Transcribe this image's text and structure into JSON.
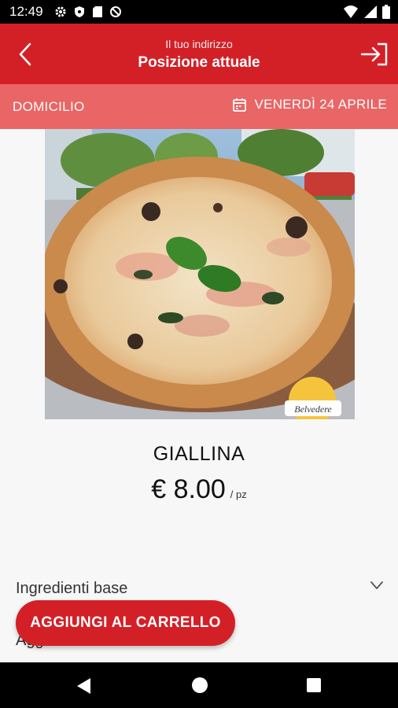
{
  "status_bar": {
    "time": "12:49",
    "left_icons": [
      "gear-icon",
      "shield-icon",
      "sd-card-icon",
      "no-disturb-icon"
    ],
    "right_icons": [
      "wifi-icon",
      "signal-icon",
      "battery-icon"
    ]
  },
  "header": {
    "subtitle": "Il tuo indirizzo",
    "title": "Posizione attuale",
    "back_icon": "chevron-left-icon",
    "login_icon": "login-icon",
    "background_color": "#d32027"
  },
  "subbar": {
    "mode": "DOMICILIO",
    "date": "VENERDÌ 24 APRILE",
    "calendar_icon": "calendar-icon",
    "background_color": "#ea6565"
  },
  "product": {
    "image_alt": "pizza",
    "logo_text": "Belvedere",
    "name": "GIALLINA",
    "price": "€ 8.00",
    "unit": "/ pz"
  },
  "sections": {
    "base_ingredients": "Ingredienti base",
    "second_partial": "Agg"
  },
  "actions": {
    "add_to_cart": "AGGIUNGI AL CARRELLO"
  },
  "nav_bar": {
    "icons": [
      "back-triangle-icon",
      "home-circle-icon",
      "recents-square-icon"
    ]
  }
}
